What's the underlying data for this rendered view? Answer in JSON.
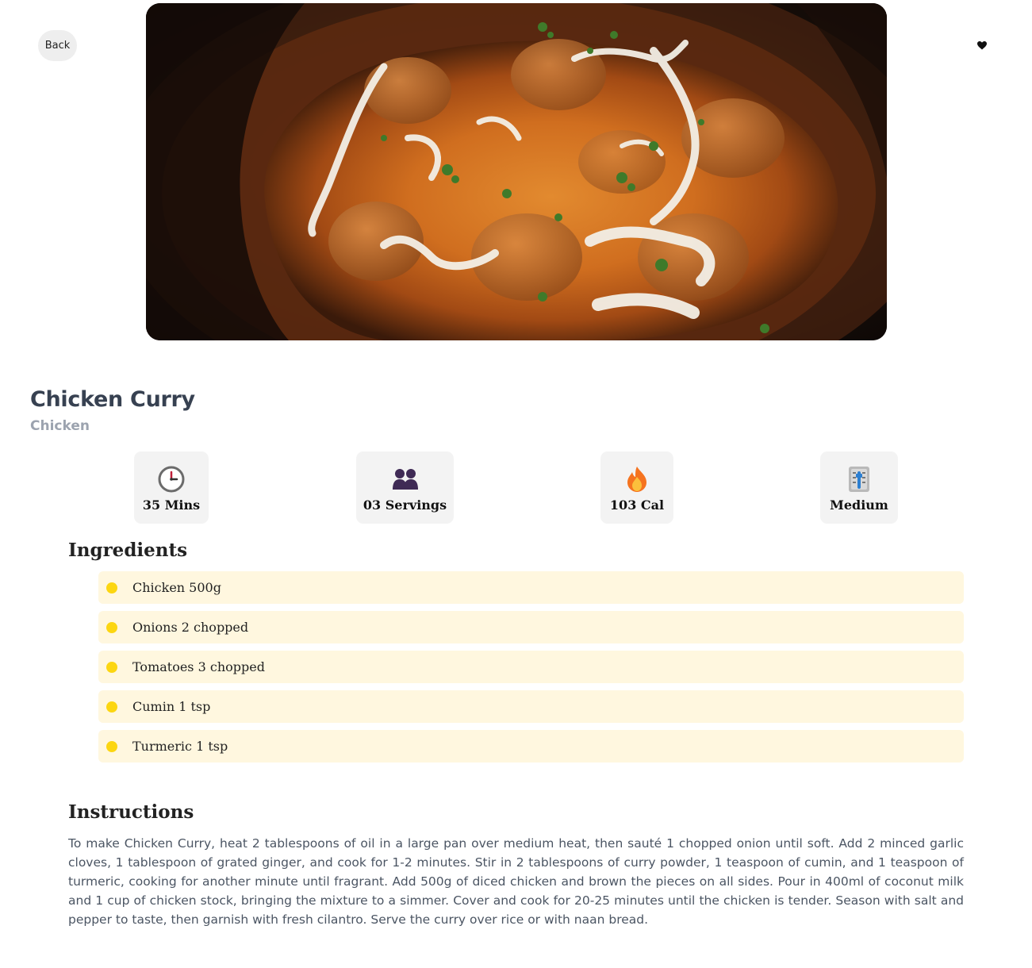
{
  "nav": {
    "back_label": "Back",
    "favorite_icon": "heart-icon"
  },
  "hero": {
    "image_subject": "chicken curry in a dark bowl with cream drizzle and cilantro"
  },
  "recipe": {
    "title": "Chicken Curry",
    "category": "Chicken"
  },
  "stats": [
    {
      "icon": "clock-icon",
      "label": "35 Mins"
    },
    {
      "icon": "people-icon",
      "label": "03 Servings"
    },
    {
      "icon": "fire-icon",
      "label": "103 Cal"
    },
    {
      "icon": "difficulty-icon",
      "label": "Medium"
    }
  ],
  "ingredients": {
    "heading": "Ingredients",
    "items": [
      "Chicken 500g",
      "Onions 2 chopped",
      "Tomatoes 3 chopped",
      "Cumin 1 tsp",
      "Turmeric 1 tsp"
    ]
  },
  "instructions": {
    "heading": "Instructions",
    "text": "To make Chicken Curry, heat 2 tablespoons of oil in a large pan over medium heat, then sauté 1 chopped onion until soft. Add 2 minced garlic cloves, 1 tablespoon of grated ginger, and cook for 1-2 minutes. Stir in 2 tablespoons of curry powder, 1 teaspoon of cumin, and 1 teaspoon of turmeric, cooking for another minute until fragrant. Add 500g of diced chicken and brown the pieces on all sides. Pour in 400ml of coconut milk and 1 cup of chicken stock, bringing the mixture to a simmer. Cover and cook for 20-25 minutes until the chicken is tender. Season with salt and pepper to taste, then garnish with fresh cilantro. Serve the curry over rice or with naan bread."
  },
  "colors": {
    "title": "#374151",
    "category": "#9ca3af",
    "stat_bg": "#f3f3f3",
    "ingredient_bg": "#fff7df",
    "bullet": "#fcd611",
    "instructions_text": "#4b5563"
  }
}
